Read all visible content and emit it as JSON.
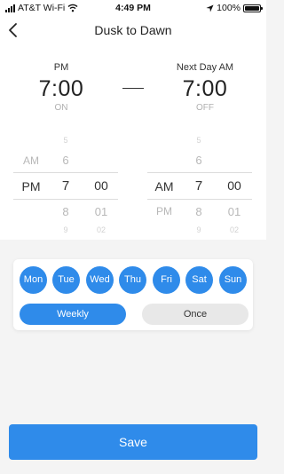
{
  "status_bar": {
    "carrier": "AT&T Wi-Fi",
    "time": "4:49 PM",
    "battery": "100%"
  },
  "header": {
    "title": "Dusk to Dawn",
    "back_icon": "chevron-left-icon"
  },
  "start": {
    "period_label": "PM",
    "time": "7:00",
    "state": "ON"
  },
  "end": {
    "period_label": "Next Day AM",
    "time": "7:00",
    "state": "OFF"
  },
  "picker_start": {
    "ampm": {
      "above": "AM",
      "selected": "PM"
    },
    "hour": {
      "far_above": "5",
      "above": "6",
      "selected": "7",
      "below": "8",
      "far_below": "9"
    },
    "minute": {
      "selected": "00",
      "below": "01",
      "far_below": "02"
    }
  },
  "picker_end": {
    "ampm": {
      "selected": "AM",
      "below": "PM"
    },
    "hour": {
      "far_above": "5",
      "above": "6",
      "selected": "7",
      "below": "8",
      "far_below": "9"
    },
    "minute": {
      "selected": "00",
      "below": "01",
      "far_below": "02"
    }
  },
  "days": [
    {
      "label": "Mon",
      "selected": true
    },
    {
      "label": "Tue",
      "selected": true
    },
    {
      "label": "Wed",
      "selected": true
    },
    {
      "label": "Thu",
      "selected": true
    },
    {
      "label": "Fri",
      "selected": true
    },
    {
      "label": "Sat",
      "selected": true
    },
    {
      "label": "Sun",
      "selected": true
    }
  ],
  "repeat": {
    "weekly": "Weekly",
    "once": "Once",
    "selected": "Weekly"
  },
  "save_label": "Save",
  "colors": {
    "accent": "#2f8bea",
    "inactive_pill": "#e8e8e8",
    "background": "#f4f4f4"
  }
}
